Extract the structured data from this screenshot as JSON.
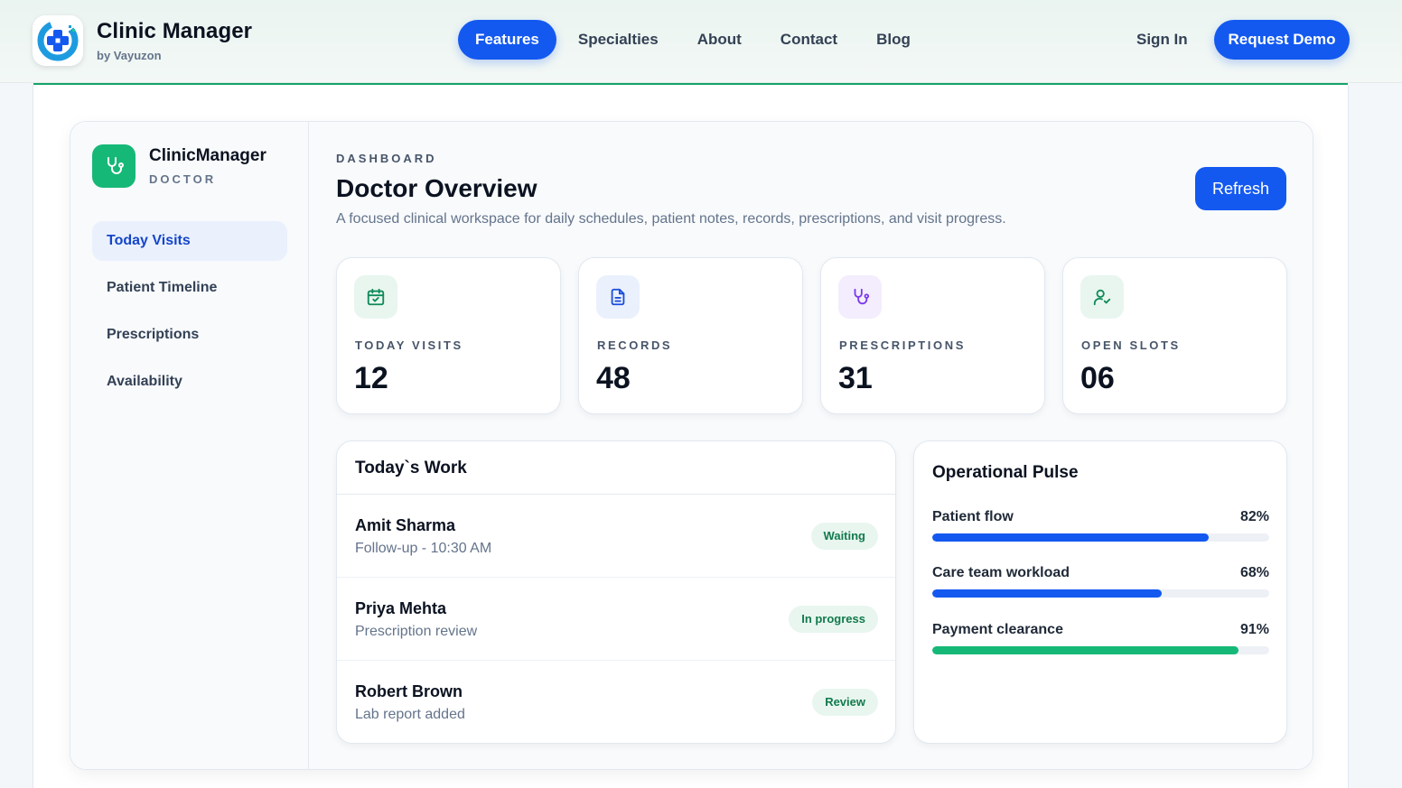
{
  "nav": {
    "brand_name": "Clinic Manager",
    "brand_sub": "by Vayuzon",
    "links": [
      {
        "label": "Features",
        "active": true
      },
      {
        "label": "Specialties",
        "active": false
      },
      {
        "label": "About",
        "active": false
      },
      {
        "label": "Contact",
        "active": false
      },
      {
        "label": "Blog",
        "active": false
      }
    ],
    "sign_in": "Sign In",
    "request_demo": "Request Demo"
  },
  "sidebar": {
    "brand_name": "ClinicManager",
    "role": "DOCTOR",
    "items": [
      {
        "label": "Today Visits",
        "active": true
      },
      {
        "label": "Patient Timeline",
        "active": false
      },
      {
        "label": "Prescriptions",
        "active": false
      },
      {
        "label": "Availability",
        "active": false
      }
    ]
  },
  "header": {
    "eyebrow": "DASHBOARD",
    "title": "Doctor Overview",
    "subtitle": "A focused clinical workspace for daily schedules, patient notes, records, prescriptions, and visit progress.",
    "refresh": "Refresh"
  },
  "stats": [
    {
      "label": "TODAY VISITS",
      "value": "12",
      "icon": "calendar-check-icon",
      "icon_color": "#0f8a5a",
      "icon_bg": "#e8f6ef"
    },
    {
      "label": "RECORDS",
      "value": "48",
      "icon": "document-icon",
      "icon_color": "#1d4ed8",
      "icon_bg": "#eaf1fd"
    },
    {
      "label": "PRESCRIPTIONS",
      "value": "31",
      "icon": "stethoscope-icon",
      "icon_color": "#7c3aed",
      "icon_bg": "#f3edfd"
    },
    {
      "label": "OPEN SLOTS",
      "value": "06",
      "icon": "user-check-icon",
      "icon_color": "#0f8a5a",
      "icon_bg": "#e8f6ef"
    }
  ],
  "work": {
    "title": "Today`s Work",
    "rows": [
      {
        "name": "Amit Sharma",
        "note": "Follow-up - 10:30 AM",
        "status": "Waiting"
      },
      {
        "name": "Priya Mehta",
        "note": "Prescription review",
        "status": "In progress"
      },
      {
        "name": "Robert Brown",
        "note": "Lab report added",
        "status": "Review"
      }
    ]
  },
  "pulse": {
    "title": "Operational Pulse",
    "metrics": [
      {
        "label": "Patient flow",
        "value_text": "82%",
        "value": 82,
        "color": "#1359f0"
      },
      {
        "label": "Care team workload",
        "value_text": "68%",
        "value": 68,
        "color": "#1359f0"
      },
      {
        "label": "Payment clearance",
        "value_text": "91%",
        "value": 91,
        "color": "#16b877"
      }
    ]
  },
  "colors": {
    "primary": "#1359f0",
    "accent_green": "#16b877",
    "status_bg": "#e8f6ef",
    "status_text": "#127a4c"
  }
}
